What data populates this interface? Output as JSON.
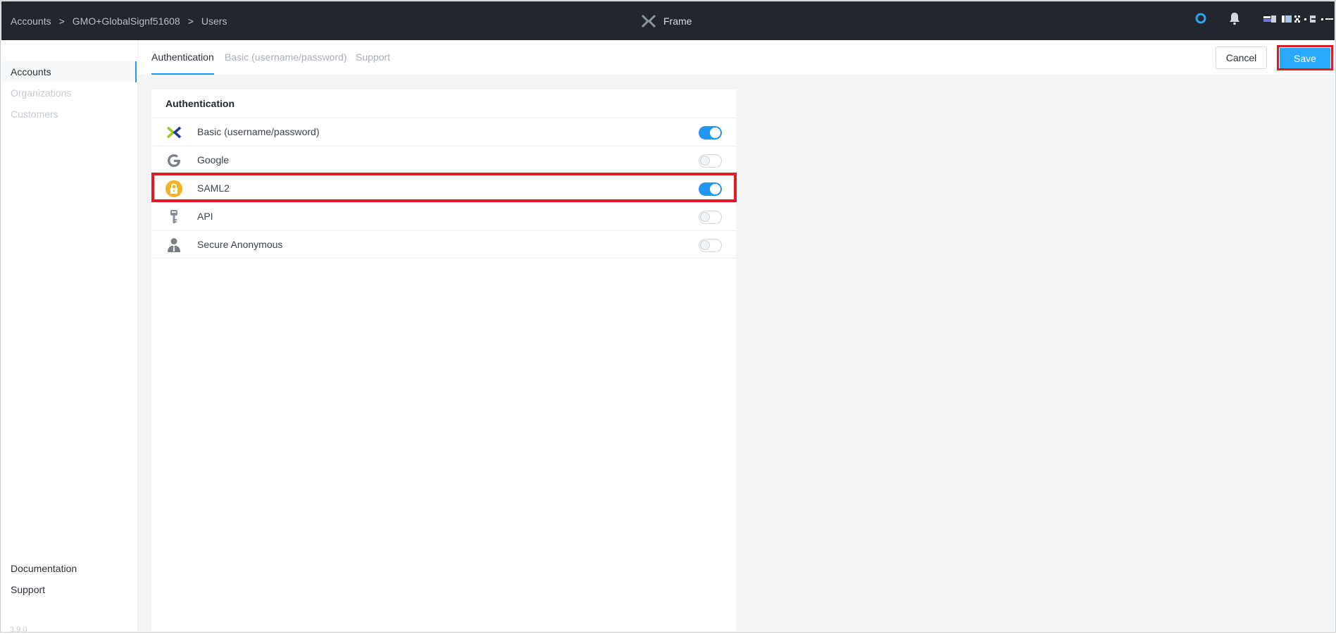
{
  "breadcrumb": {
    "items": [
      "Accounts",
      "GMO+GlobalSignf51608",
      "Users"
    ],
    "separator": ">"
  },
  "brand": {
    "name": "Frame"
  },
  "sidebar": {
    "items": [
      {
        "label": "Accounts",
        "active": true
      },
      {
        "label": "Organizations",
        "active": false
      },
      {
        "label": "Customers",
        "active": false
      }
    ],
    "bottom_links": [
      "Documentation",
      "Support"
    ],
    "version": "3.9.0"
  },
  "tabs": [
    {
      "label": "Authentication",
      "active": true
    },
    {
      "label": "Basic (username/password)",
      "active": false
    },
    {
      "label": "Support",
      "active": false
    }
  ],
  "actions": {
    "cancel_label": "Cancel",
    "save_label": "Save"
  },
  "auth_card": {
    "title": "Authentication",
    "providers": [
      {
        "label": "Basic (username/password)",
        "icon": "frame-x-logo-icon",
        "enabled": true
      },
      {
        "label": "Google",
        "icon": "google-g-icon",
        "enabled": false
      },
      {
        "label": "SAML2",
        "icon": "lock-icon",
        "enabled": true
      },
      {
        "label": "API",
        "icon": "key-icon",
        "enabled": false
      },
      {
        "label": "Secure Anonymous",
        "icon": "anonymous-user-icon",
        "enabled": false
      }
    ]
  },
  "colors": {
    "topbar": "#22272e",
    "accent": "#2196f3",
    "save_button": "#28a8ff",
    "highlight": "#e21a23",
    "saml_icon": "#f0b429"
  }
}
